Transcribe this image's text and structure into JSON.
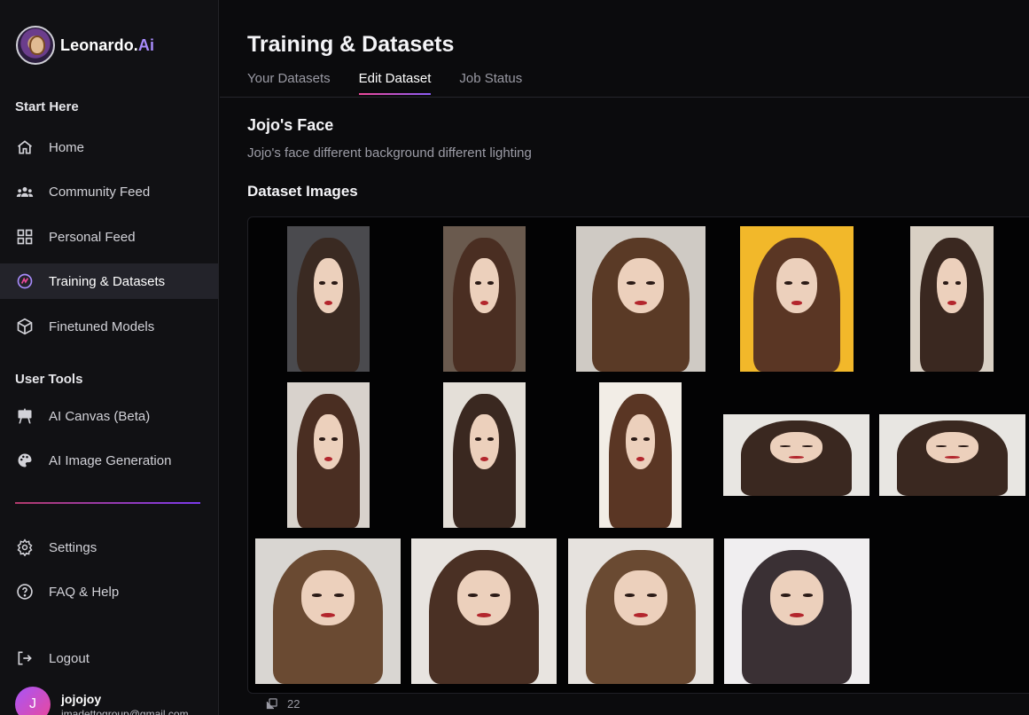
{
  "app": {
    "name": "Leonardo.",
    "name_accent": "Ai"
  },
  "sidebar": {
    "sections": {
      "start_here": "Start Here",
      "user_tools": "User Tools"
    },
    "items": [
      {
        "label": "Home",
        "icon": "home-icon"
      },
      {
        "label": "Community Feed",
        "icon": "community-icon"
      },
      {
        "label": "Personal Feed",
        "icon": "grid-icon"
      },
      {
        "label": "Training & Datasets",
        "icon": "training-icon",
        "active": true
      },
      {
        "label": "Finetuned Models",
        "icon": "cube-icon"
      },
      {
        "label": "AI Canvas (Beta)",
        "icon": "easel-icon"
      },
      {
        "label": "AI Image Generation",
        "icon": "palette-icon"
      },
      {
        "label": "Settings",
        "icon": "gear-icon"
      },
      {
        "label": "FAQ & Help",
        "icon": "help-icon"
      },
      {
        "label": "Logout",
        "icon": "logout-icon"
      }
    ],
    "user": {
      "initial": "J",
      "name": "jojojoy",
      "email": "jmadettogroup@gmail.com"
    }
  },
  "main": {
    "title": "Training & Datasets",
    "tabs": [
      {
        "label": "Your Datasets"
      },
      {
        "label": "Edit Dataset",
        "active": true
      },
      {
        "label": "Job Status"
      }
    ],
    "dataset": {
      "name": "Jojo's Face",
      "description": "Jojo's face different background different lighting",
      "images_title": "Dataset Images",
      "image_count": "22"
    }
  },
  "colors": {
    "accent_gradient_start": "#ec4899",
    "accent_gradient_end": "#8b5cf6",
    "background": "#0b0b0d",
    "sidebar": "#111114"
  }
}
